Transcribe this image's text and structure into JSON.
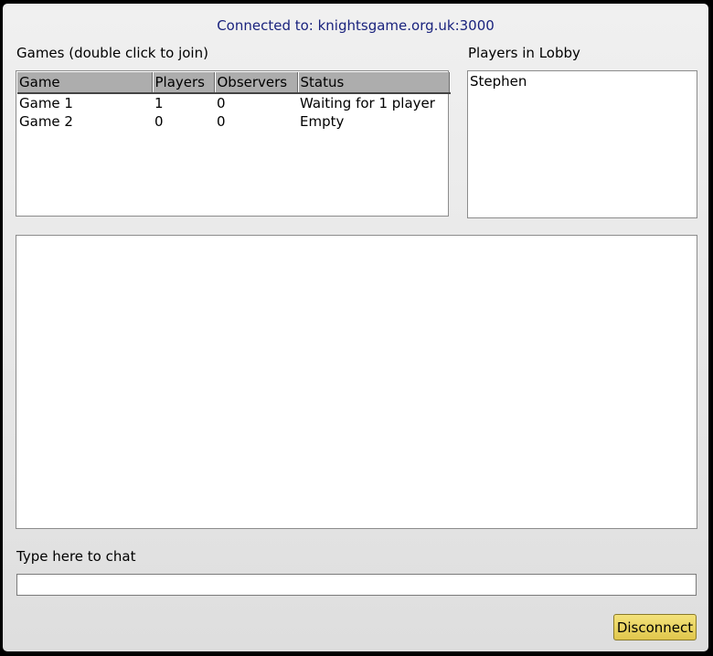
{
  "connection": {
    "text": "Connected to: knightsgame.org.uk:3000"
  },
  "games": {
    "label": "Games (double click to join)",
    "columns": [
      "Game",
      "Players",
      "Observers",
      "Status"
    ],
    "rows": [
      [
        "Game 1",
        "1",
        "0",
        "Waiting for 1 player"
      ],
      [
        "Game 2",
        "0",
        "0",
        "Empty"
      ]
    ]
  },
  "lobby": {
    "label": "Players in Lobby",
    "players": [
      "Stephen"
    ]
  },
  "chat": {
    "label": "Type here to chat",
    "input_value": ""
  },
  "actions": {
    "disconnect_label": "Disconnect"
  },
  "colors": {
    "connection_text": "#1a237e",
    "table_header_bg": "#adadad",
    "disconnect_button": "#ecd565"
  }
}
